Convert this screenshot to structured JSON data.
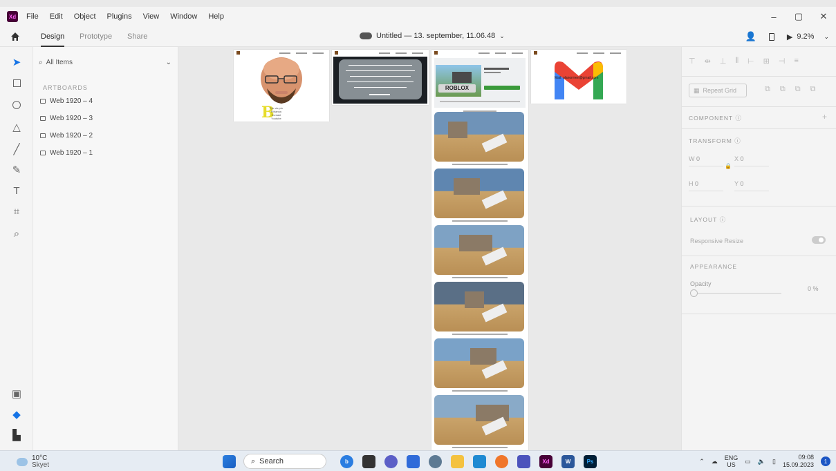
{
  "menubar": {
    "logo": "Xd",
    "items": [
      "File",
      "Edit",
      "Object",
      "Plugins",
      "View",
      "Window",
      "Help"
    ],
    "controls": [
      "–",
      "▢",
      "✕"
    ]
  },
  "topbar": {
    "tabs": [
      "Design",
      "Prototype",
      "Share"
    ],
    "document_title": "Untitled — 13. september, 11.06.48",
    "zoom": "9.2%"
  },
  "layers": {
    "search_label": "All Items",
    "section": "ARTBOARDS",
    "artboards": [
      "Web 1920 – 4",
      "Web 1920 – 3",
      "Web 1920 – 2",
      "Web 1920 – 1"
    ]
  },
  "canvas": {
    "board1_caption": "Tyk via pin",
    "board1_lines": [
      "Rihanna",
      "Kontakt",
      "Youtube"
    ],
    "board3_brand": "ROBLOX",
    "board4_email": "Mail: olanormen@gmail.com"
  },
  "props": {
    "repeat_grid": "Repeat Grid",
    "component": "COMPONENT",
    "transform": "TRANSFORM",
    "w_label": "W",
    "w_value": "0",
    "h_label": "H",
    "h_value": "0",
    "x_label": "X",
    "x_value": "0",
    "y_label": "Y",
    "y_value": "0",
    "layout": "LAYOUT",
    "responsive_resize": "Responsive Resize",
    "appearance": "APPEARANCE",
    "opacity_label": "Opacity",
    "opacity_value": "0 %"
  },
  "taskbar": {
    "temperature": "10°C",
    "weather": "Skyet",
    "search": "Search",
    "lang1": "ENG",
    "lang2": "US",
    "time": "09:08",
    "date": "15.09.2023",
    "notifications": "1"
  },
  "colors": {
    "xd_bg": "#470137",
    "xd_fg": "#ff61f6",
    "accent_blue": "#1473e6"
  }
}
